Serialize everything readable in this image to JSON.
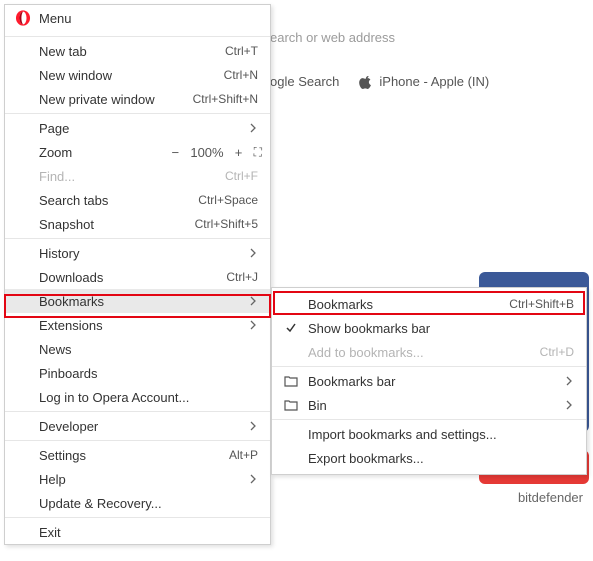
{
  "background": {
    "address_placeholder": "earch or web address",
    "bookmark_bar": {
      "google_label": "ogle Search",
      "apple_label": "iPhone - Apple (IN)"
    },
    "footer_word": "bitdefender"
  },
  "menu": {
    "title": "Menu",
    "items": {
      "new_tab": {
        "label": "New tab",
        "shortcut": "Ctrl+T"
      },
      "new_window": {
        "label": "New window",
        "shortcut": "Ctrl+N"
      },
      "new_private": {
        "label": "New private window",
        "shortcut": "Ctrl+Shift+N"
      },
      "page": {
        "label": "Page"
      },
      "zoom": {
        "label": "Zoom",
        "value": "100%"
      },
      "find": {
        "label": "Find...",
        "shortcut": "Ctrl+F"
      },
      "search_tabs": {
        "label": "Search tabs",
        "shortcut": "Ctrl+Space"
      },
      "snapshot": {
        "label": "Snapshot",
        "shortcut": "Ctrl+Shift+5"
      },
      "history": {
        "label": "History"
      },
      "downloads": {
        "label": "Downloads",
        "shortcut": "Ctrl+J"
      },
      "bookmarks": {
        "label": "Bookmarks"
      },
      "extensions": {
        "label": "Extensions"
      },
      "news": {
        "label": "News"
      },
      "pinboards": {
        "label": "Pinboards"
      },
      "login": {
        "label": "Log in to Opera Account..."
      },
      "developer": {
        "label": "Developer"
      },
      "settings": {
        "label": "Settings",
        "shortcut": "Alt+P"
      },
      "help": {
        "label": "Help"
      },
      "update": {
        "label": "Update & Recovery..."
      },
      "exit": {
        "label": "Exit"
      }
    }
  },
  "submenu": {
    "bookmarks": {
      "label": "Bookmarks",
      "shortcut": "Ctrl+Shift+B"
    },
    "show_bar": {
      "label": "Show bookmarks bar"
    },
    "add": {
      "label": "Add to bookmarks...",
      "shortcut": "Ctrl+D"
    },
    "bookmarks_bar": {
      "label": "Bookmarks bar"
    },
    "bin": {
      "label": "Bin"
    },
    "import": {
      "label": "Import bookmarks and settings..."
    },
    "export": {
      "label": "Export bookmarks..."
    }
  },
  "icons": {
    "minus": "−",
    "plus": "+",
    "fullscreen": "⛶"
  }
}
